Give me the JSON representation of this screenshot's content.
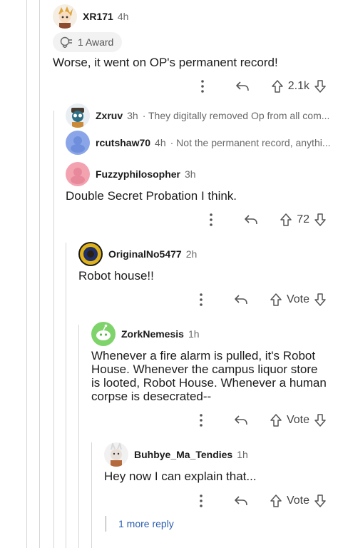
{
  "comments": [
    {
      "username": "XR171",
      "time": "4h",
      "award": "1 Award",
      "body": "Worse, it went on OP's permanent record!",
      "votes": "2.1k"
    },
    {
      "username": "Zxruv",
      "time": "3h",
      "preview": "· They digitally removed Op from all com..."
    },
    {
      "username": "rcutshaw70",
      "time": "4h",
      "preview": "· Not the permanent record, anythi..."
    },
    {
      "username": "Fuzzyphilosopher",
      "time": "3h",
      "body": "Double Secret Probation I think.",
      "votes": "72"
    },
    {
      "username": "OriginalNo5477",
      "time": "2h",
      "body": "Robot house!!",
      "votes": "Vote"
    },
    {
      "username": "ZorkNemesis",
      "time": "1h",
      "body_lines": [
        "Whenever a fire alarm is pulled, it's Robot",
        "House. Whenever the campus liquor store",
        "is looted, Robot House. Whenever a human",
        "corpse is desecrated--"
      ],
      "votes": "Vote"
    },
    {
      "username": "Buhbye_Ma_Tendies",
      "time": "1h",
      "body": "Hey now I can explain that...",
      "votes": "Vote"
    }
  ],
  "more_replies": "1 more reply",
  "icons": [
    "more-vertical-icon",
    "reply-icon",
    "upvote-icon",
    "downvote-icon",
    "award-icon"
  ],
  "colors": {
    "link": "#2a5db0",
    "meta": "#6a6a6a",
    "thread_line": "#d6d6d6"
  }
}
